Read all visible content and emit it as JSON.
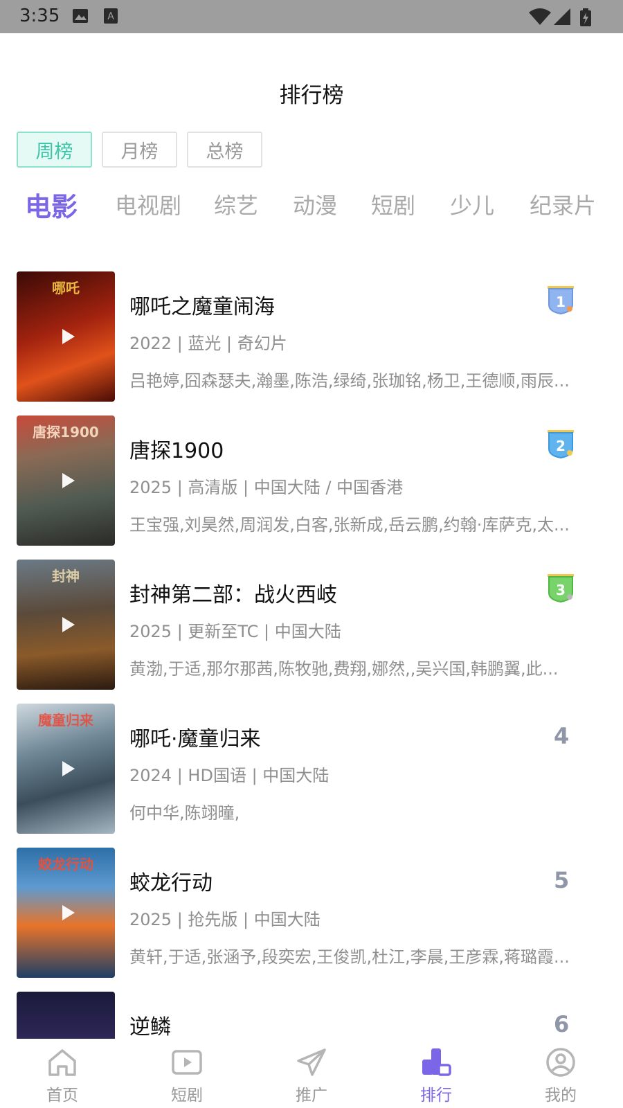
{
  "status_bar": {
    "time": "3:35",
    "icons": [
      "image-icon",
      "font-a-icon",
      "wifi-icon",
      "signal-icon",
      "battery-icon"
    ]
  },
  "header": {
    "title": "排行榜"
  },
  "period_tabs": [
    {
      "label": "周榜",
      "active": true
    },
    {
      "label": "月榜",
      "active": false
    },
    {
      "label": "总榜",
      "active": false
    }
  ],
  "category_tabs": [
    {
      "label": "电影",
      "active": true
    },
    {
      "label": "电视剧",
      "active": false
    },
    {
      "label": "综艺",
      "active": false
    },
    {
      "label": "动漫",
      "active": false
    },
    {
      "label": "短剧",
      "active": false
    },
    {
      "label": "少儿",
      "active": false
    },
    {
      "label": "纪录片",
      "active": false
    }
  ],
  "items": [
    {
      "rank": "1",
      "title": "哪吒之魔童闹海",
      "meta": "2022 | 蓝光 | 奇幻片",
      "cast": "吕艳婷,囧森瑟夫,瀚墨,陈浩,绿绮,张珈铭,杨卫,王德顺,雨辰...",
      "poster_text": "哪吒"
    },
    {
      "rank": "2",
      "title": "唐探1900",
      "meta": "2025 | 高清版 | 中国大陆 / 中国香港",
      "cast": "王宝强,刘昊然,周润发,白客,张新成,岳云鹏,约翰·库萨克,太...",
      "poster_text": "唐探1900"
    },
    {
      "rank": "3",
      "title": "封神第二部：战火西岐",
      "meta": "2025 | 更新至TC | 中国大陆",
      "cast": "黄渤,于适,那尔那茜,陈牧驰,费翔,娜然,,吴兴国,韩鹏翼,此...",
      "poster_text": "封神"
    },
    {
      "rank": "4",
      "title": "哪吒·魔童归来",
      "meta": "2024 | HD国语 | 中国大陆",
      "cast": "何中华,陈翊曈,",
      "poster_text": "魔童归来"
    },
    {
      "rank": "5",
      "title": "蛟龙行动",
      "meta": "2025 | 抢先版 | 中国大陆",
      "cast": "黄轩,于适,张涵予,段奕宏,王俊凯,杜江,李晨,王彦霖,蒋璐霞...",
      "poster_text": "蛟龙行动"
    },
    {
      "rank": "6",
      "title": "逆鳞",
      "meta": "",
      "cast": "",
      "poster_text": ""
    }
  ],
  "tab_bar": [
    {
      "label": "首页",
      "icon": "home-icon",
      "active": false
    },
    {
      "label": "短剧",
      "icon": "video-play-icon",
      "active": false
    },
    {
      "label": "推广",
      "icon": "paper-plane-icon",
      "active": false
    },
    {
      "label": "排行",
      "icon": "ranking-icon",
      "active": true
    },
    {
      "label": "我的",
      "icon": "user-icon",
      "active": false
    }
  ],
  "colors": {
    "accent": "#7c66e8",
    "period_active": "#3cc5a7",
    "muted_text": "#8f8f8f",
    "status_bar": "#9e9e9e"
  }
}
